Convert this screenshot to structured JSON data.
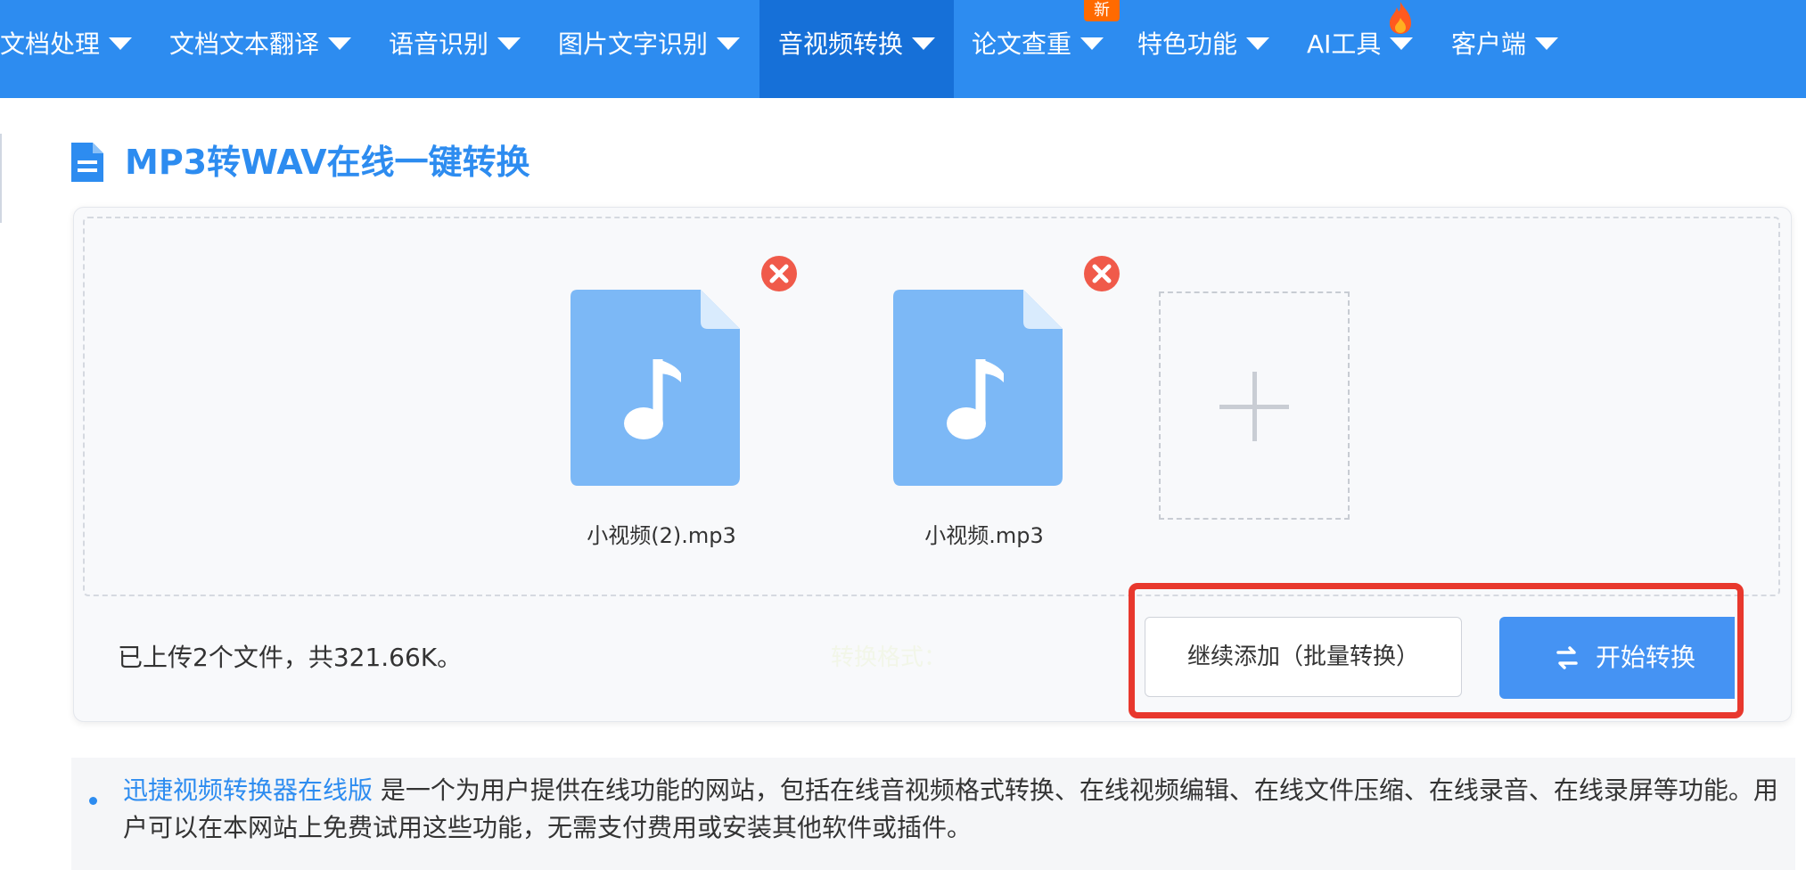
{
  "nav": {
    "items": [
      {
        "label": "文档处理"
      },
      {
        "label": "文档文本翻译"
      },
      {
        "label": "语音识别"
      },
      {
        "label": "图片文字识别"
      },
      {
        "label": "音视频转换"
      },
      {
        "label": "论文查重"
      },
      {
        "label": "特色功能"
      },
      {
        "label": "AI工具"
      },
      {
        "label": "客户端"
      }
    ],
    "active_index": 4,
    "new_badge": "新"
  },
  "page": {
    "title": "MP3转WAV在线一键转换"
  },
  "upload": {
    "files": [
      {
        "name": "小视频(2).mp3"
      },
      {
        "name": "小视频.mp3"
      }
    ],
    "status": "已上传2个文件，共321.66K。",
    "faint_label": "转换格式：",
    "continue_button": "继续添加（批量转换）",
    "start_button": "开始转换"
  },
  "description": {
    "link_text": "迅捷视频转换器在线版",
    "text": " 是一个为用户提供在线功能的网站，包括在线音视频格式转换、在线视频编辑、在线文件压缩、在线录音、在线录屏等功能。用户可以在本网站上免费试用这些功能，无需支付费用或安装其他软件或插件。"
  },
  "colors": {
    "nav_bg": "#2d8cf0",
    "nav_active": "#1670d8",
    "accent": "#2d8cf0",
    "file_icon": "#7cb8f6",
    "remove": "#f05a4a",
    "highlight": "#e8382d",
    "start_button": "#4593f3"
  }
}
